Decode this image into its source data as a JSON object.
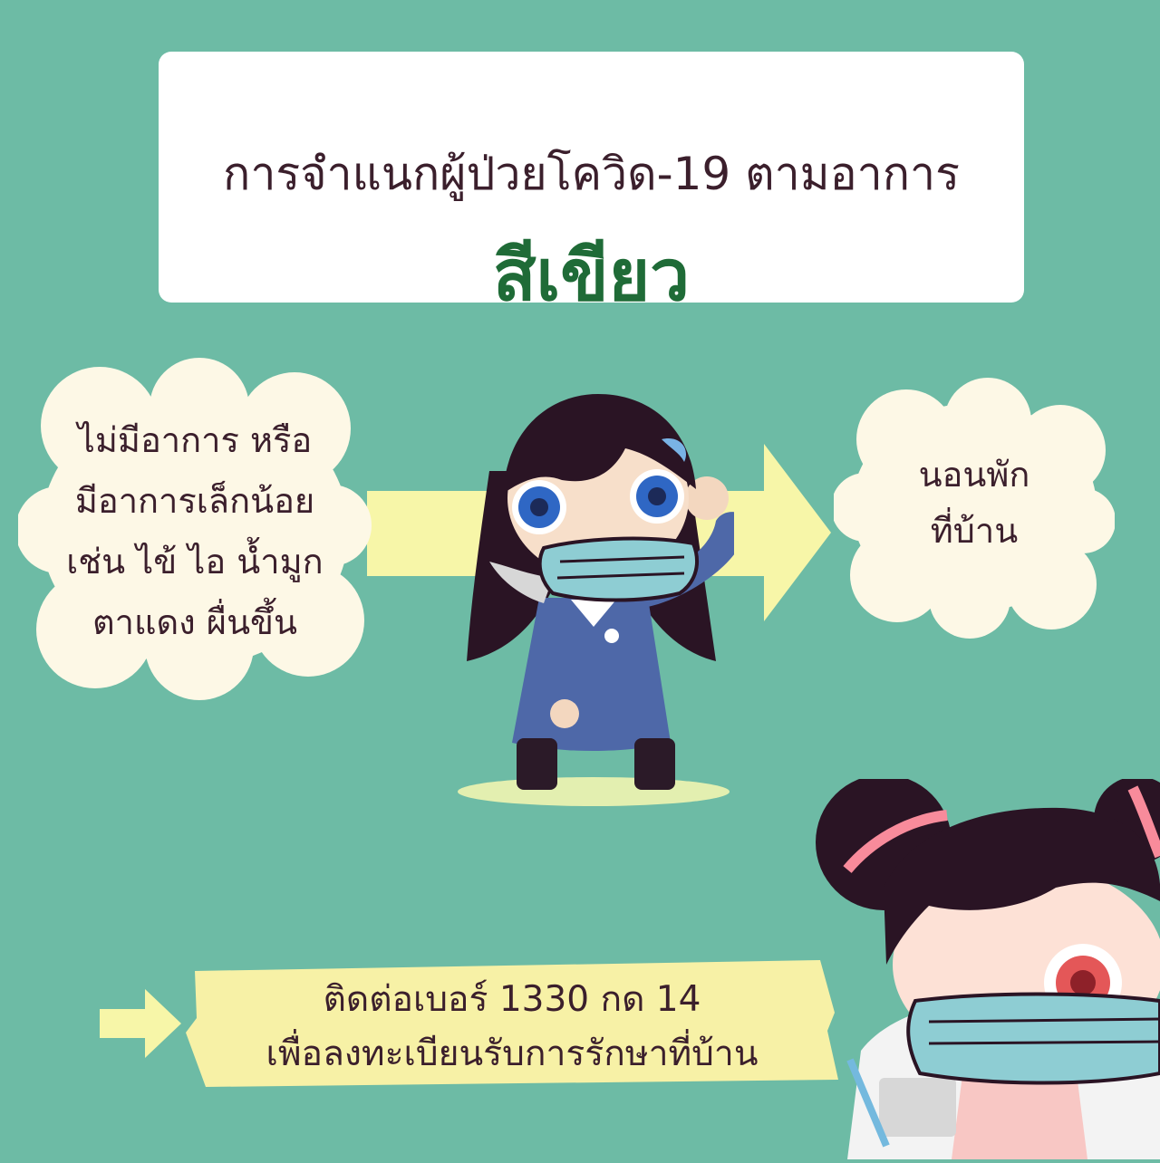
{
  "title_card": {
    "subtitle": "การจำแนกผู้ป่วยโควิด-19 ตามอาการ",
    "heading": "สีเขียว"
  },
  "left_cloud": {
    "lines": [
      "ไม่มีอาการ หรือ",
      "มีอาการเล็กน้อย",
      "เช่น ไข้ ไอ น้ำมูก",
      "ตาแดง ผื่นขึ้น"
    ]
  },
  "right_cloud": {
    "lines": [
      "นอนพัก",
      "ที่บ้าน"
    ]
  },
  "contact": {
    "lines": [
      "ติดต่อเบอร์ 1330 กด 14",
      "เพื่อลงทะเบียนรับการรักษาที่บ้าน"
    ]
  },
  "colors": {
    "background": "#6dbba5",
    "heading_green": "#1f6b37",
    "text_dark": "#3b1f2c",
    "cloud_fill": "#fdf8e6",
    "arrow_yellow": "#f7f6a8",
    "highlight_yellow": "#f7f1a6"
  },
  "icons": {
    "main_arrow": "arrow-right-icon",
    "contact_arrow": "arrow-right-icon"
  }
}
